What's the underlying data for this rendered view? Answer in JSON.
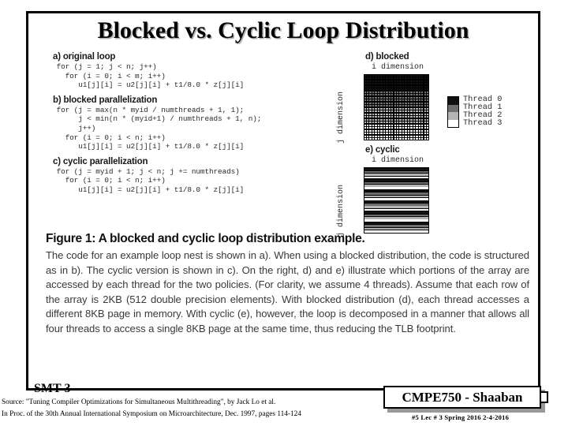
{
  "slide": {
    "title": "Blocked vs.  Cyclic Loop Distribution",
    "smt_label": "SMT-3"
  },
  "code_sections": [
    {
      "heading": "a) original loop",
      "code": "   for (j = 1; j < n; j++)\n     for (i = 0; i < m; i++)\n        u1[j][i] = u2[j][i] + t1/8.0 * z[j][i]"
    },
    {
      "heading": "b) blocked parallelization",
      "code": "   for (j = max(n * myid / numthreads + 1, 1);\n        j < min(n * (myid+1) / numthreads + 1, n);\n        j++)\n     for (i = 0; i < n; i++)\n        u1[j][i] = u2[j][i] + t1/8.0 * z[j][i]"
    },
    {
      "heading": "c) cyclic parallelization",
      "code": "   for (j = myid + 1; j < n; j += numthreads)\n     for (i = 0; i < n; i++)\n        u1[j][i] = u2[j][i] + t1/8.0 * z[j][i]"
    }
  ],
  "diagrams": {
    "blocked": {
      "heading": "d) blocked",
      "x_axis_label": "i dimension",
      "y_axis_label": "j dimension"
    },
    "cyclic": {
      "heading": "e) cyclic",
      "x_axis_label": "i dimension",
      "y_axis_label": "j dimension"
    },
    "legend": {
      "items": [
        {
          "label": "Thread 0",
          "color": "#111111"
        },
        {
          "label": "Thread 1",
          "color": "#6e6e6e"
        },
        {
          "label": "Thread 2",
          "color": "#b4b4b4"
        },
        {
          "label": "Thread 3",
          "color": "#ffffff"
        }
      ]
    },
    "thread_colors": [
      "#111111",
      "#6e6e6e",
      "#b4b4b4",
      "#ffffff"
    ]
  },
  "figure": {
    "caption": "Figure 1: A blocked and cyclic loop distribution example.",
    "body": "The code for an example loop nest is shown in a). When using a blocked distribution, the code is structured as in b). The cyclic version is shown in c). On the right, d) and e) illustrate which portions of the array are accessed by each thread for the two policies. (For clarity, we assume 4 threads). Assume that each row of the array is 2KB (512 double precision elements). With blocked distribution (d), each thread accesses a different 8KB page in memory. With cyclic (e), however, the loop is decomposed in a manner that allows all four threads to access a single 8KB page at the same time, thus reducing the TLB footprint."
  },
  "source": {
    "line1": "Source: \"Tuning Compiler Optimizations for Simultaneous Multithreading\", by Jack Lo et al.",
    "line2": "In Proc. of the 30th Annual International Symposium on Microarchitecture, Dec. 1997, pages 114-124"
  },
  "footer": {
    "badge": "CMPE750 - Shaaban",
    "meta": "#5  Lec # 3   Spring 2016  2-4-2016"
  }
}
